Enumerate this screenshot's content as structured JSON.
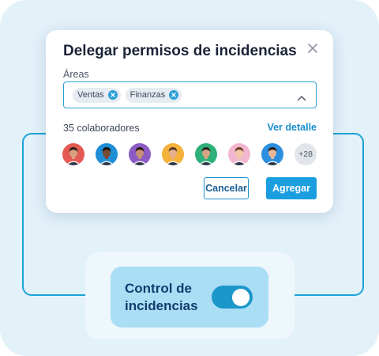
{
  "dialog": {
    "title": "Delegar permisos de incidencias",
    "areas_label": "Áreas",
    "chips": [
      "Ventas",
      "Finanzas"
    ],
    "collaborators_count": "35 colaboradores",
    "see_detail_label": "Ver detalle",
    "more_avatars": "+28",
    "cancel_label": "Cancelar",
    "add_label": "Agregar"
  },
  "feature_toggle": {
    "label": "Control de incidencias",
    "enabled": true
  },
  "avatars": [
    {
      "name": "avatar-1",
      "bg": "#e25a52",
      "skin": "#d9a07d",
      "hair": "#2a1d16"
    },
    {
      "name": "avatar-2",
      "bg": "#1e8fd6",
      "skin": "#7a4a30",
      "hair": "#1a120d"
    },
    {
      "name": "avatar-3",
      "bg": "#8c5bc4",
      "skin": "#c99074",
      "hair": "#2b1a12"
    },
    {
      "name": "avatar-4",
      "bg": "#f5b23a",
      "skin": "#e6b08c",
      "hair": "#5a3a22"
    },
    {
      "name": "avatar-5",
      "bg": "#2fb07a",
      "skin": "#d8a482",
      "hair": "#2a2520"
    },
    {
      "name": "avatar-6",
      "bg": "#f2b6cf",
      "skin": "#f0c8a8",
      "hair": "#6b3f24"
    },
    {
      "name": "avatar-7",
      "bg": "#2b8fe0",
      "skin": "#e8b896",
      "hair": "#2a1a10"
    }
  ],
  "colors": {
    "accent": "#1a9ee0",
    "panel_bg": "#e3f1f9",
    "connector": "#1aa3d6",
    "toggle_card": "#a9def5",
    "toggle_on": "#1b97c9"
  }
}
